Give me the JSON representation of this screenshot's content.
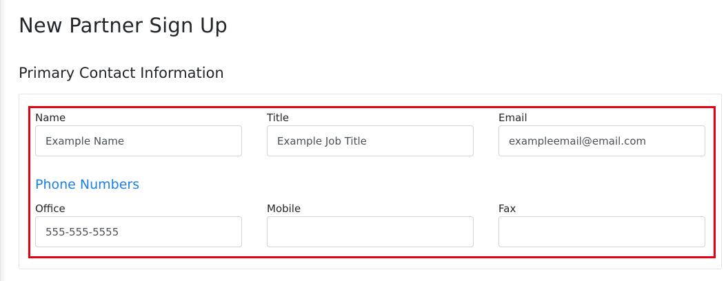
{
  "page": {
    "title": "New Partner Sign Up",
    "section_title": "Primary Contact Information"
  },
  "contact": {
    "name": {
      "label": "Name",
      "placeholder": "Example Name",
      "value": ""
    },
    "title": {
      "label": "Title",
      "placeholder": "Example Job Title",
      "value": ""
    },
    "email": {
      "label": "Email",
      "placeholder": "exampleemail@email.com",
      "value": ""
    }
  },
  "phones": {
    "heading": "Phone Numbers",
    "office": {
      "label": "Office",
      "placeholder": "555-555-5555",
      "value": ""
    },
    "mobile": {
      "label": "Mobile",
      "placeholder": "",
      "value": ""
    },
    "fax": {
      "label": "Fax",
      "placeholder": "",
      "value": ""
    }
  },
  "colors": {
    "highlight": "#e4000f",
    "subsection": "#1a7fe6"
  }
}
